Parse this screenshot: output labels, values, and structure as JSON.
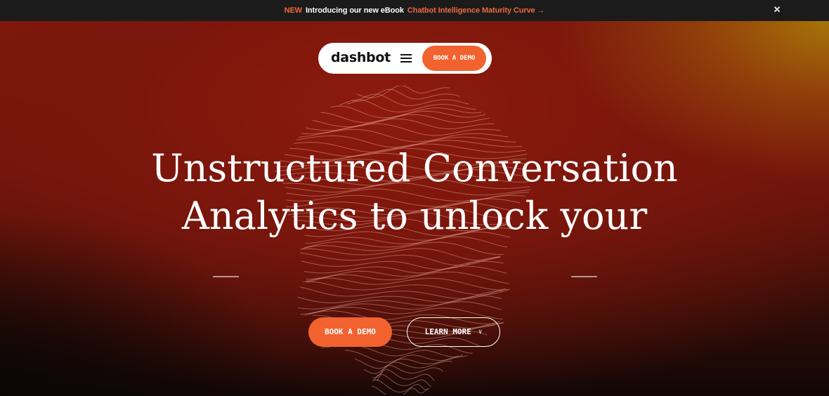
{
  "announcement": {
    "new_tag": "NEW",
    "intro": "Introducing our new eBook",
    "link": "Chatbot Intelligence Maturity Curve →",
    "close_icon": "close-icon"
  },
  "nav": {
    "logo": "dashbot",
    "menu_icon": "hamburger-menu-icon",
    "demo_button": "BOOK A DEMO"
  },
  "hero": {
    "headline_line1": "Unstructured Conversation",
    "headline_line2": "Analytics to unlock your",
    "primary_cta": "BOOK A DEMO",
    "secondary_cta": "LEARN MORE",
    "secondary_cta_icon": "chevron-down-icon"
  },
  "colors": {
    "accent": "#f2622f",
    "announcement_bg": "#1c1b1b",
    "hero_red": "#851a0e",
    "hero_gold": "#a87808"
  }
}
